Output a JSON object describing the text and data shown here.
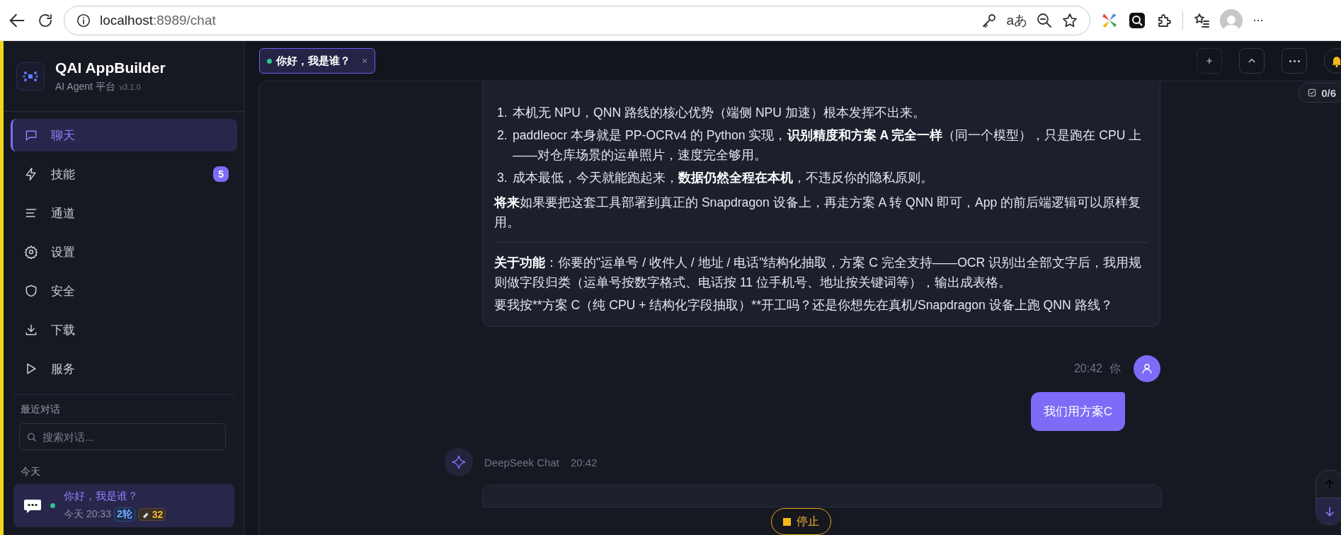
{
  "browser": {
    "url_host": "localhost",
    "url_path": ":8989/chat",
    "translate_label": "aあ",
    "more_label": "···"
  },
  "sidebar": {
    "app_name": "QAI AppBuilder",
    "subtitle": "AI Agent 平台",
    "version": "v3.1.0",
    "nav": [
      {
        "label": "聊天",
        "selected": true
      },
      {
        "label": "技能",
        "selected": false,
        "badge": "5"
      },
      {
        "label": "通道",
        "selected": false
      },
      {
        "label": "设置",
        "selected": false
      },
      {
        "label": "安全",
        "selected": false
      },
      {
        "label": "下载",
        "selected": false
      },
      {
        "label": "服务",
        "selected": false
      }
    ],
    "recent_heading": "最近对话",
    "search": {
      "placeholder": "搜索对话..."
    },
    "group_label": "今天",
    "conversations": [
      {
        "title": "你好，我是谁？",
        "time": "今天 20:33",
        "rounds": "2轮",
        "tools": "32",
        "selected": true,
        "online": true
      }
    ]
  },
  "tabs": [
    {
      "label": "你好，我是谁？",
      "selected": true,
      "online": true,
      "close": "×"
    }
  ],
  "todo_counter": "0/6",
  "messages": [
    {
      "kind": "assistant",
      "blocks": [
        {
          "kind": "list",
          "items": [
            {
              "marker": "1.",
              "text": "本机无 NPU，QNN 路线的核心优势（端侧 NPU 加速）根本发挥不出来。"
            },
            {
              "marker": "2.",
              "text": "paddleocr 本身就是 PP-OCRv4 的 Python 实现，**识别精度和方案 A 完全一样**（同一个模型），只是跑在 CPU 上——对仓库场景的运单照片，速度完全够用。"
            },
            {
              "marker": "3.",
              "text": "成本最低，今天就能跑起来，**数据仍然全程在本机**，不违反你的隐私原则。"
            }
          ]
        },
        {
          "kind": "paragraph",
          "text": "**将来**如果要把这套工具部署到真正的 Snapdragon 设备上，再走方案 A 转 QNN 即可，App 的前后端逻辑可以原样复用。"
        },
        {
          "kind": "divider"
        },
        {
          "kind": "paragraph",
          "text": "**关于功能**：你要的\"运单号 / 收件人 / 地址 / 电话\"结构化抽取，方案 C 完全支持——OCR 识别出全部文字后，我用规则做字段归类（运单号按数字格式、电话按 11 位手机号、地址按关键词等），输出成表格。"
        },
        {
          "kind": "plain",
          "text": "要我按**方案 C（纯 CPU + 结构化字段抽取）**开工吗？还是你想先在真机/Snapdragon 设备上跑 QNN 路线？"
        }
      ]
    },
    {
      "kind": "user",
      "time": "20:42",
      "author": "你",
      "text": "我们用方案C"
    },
    {
      "kind": "assistant_header",
      "author": "DeepSeek Chat",
      "time": "20:42"
    }
  ],
  "stop_button": "停止"
}
